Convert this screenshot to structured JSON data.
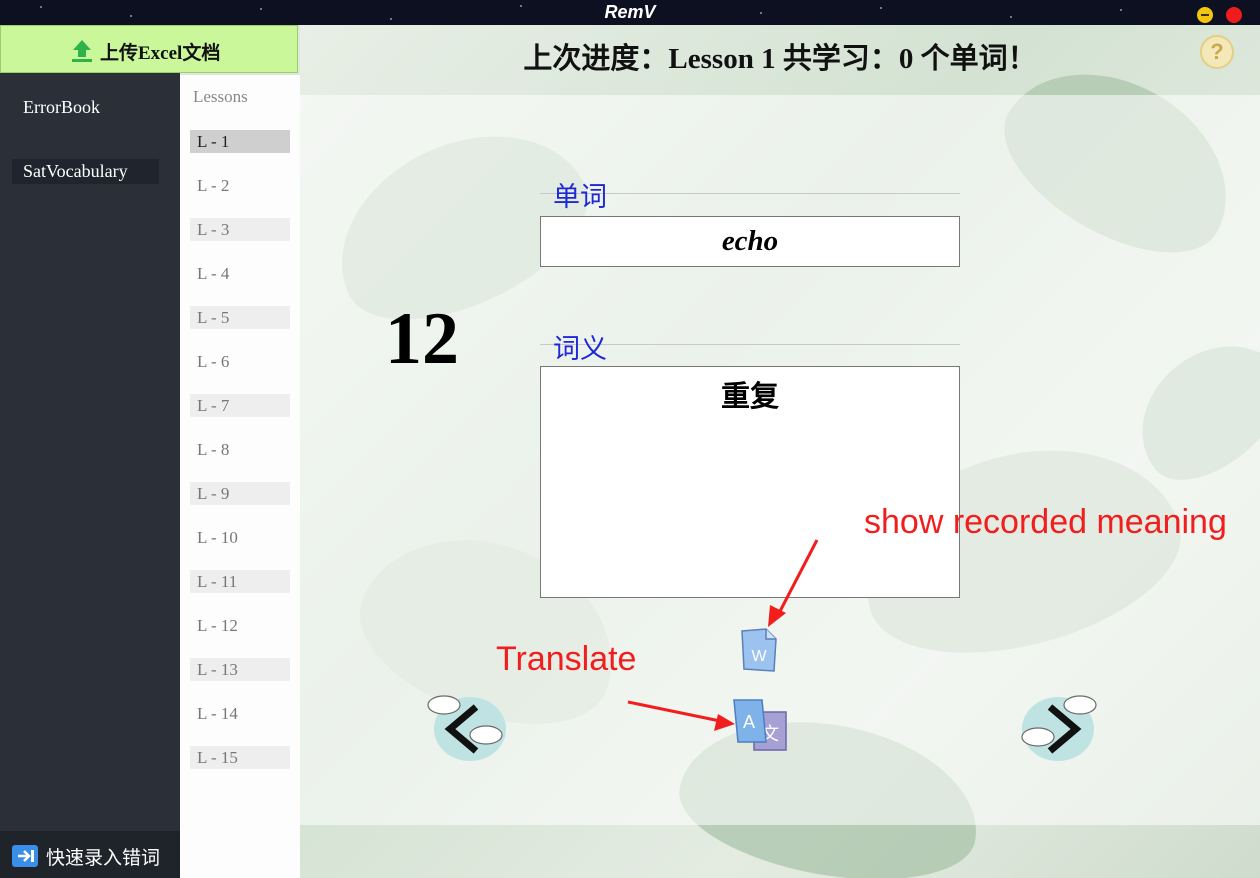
{
  "app": {
    "title": "RemV"
  },
  "sidebar": {
    "upload_label": "上传Excel文档",
    "vocabularies": [
      {
        "label": "ErrorBook"
      },
      {
        "label": "SatVocabulary"
      }
    ],
    "quick_entry_label": "快速录入错词"
  },
  "lessons": {
    "header": "Lessons",
    "items": [
      "L - 1",
      "L - 2",
      "L - 3",
      "L - 4",
      "L - 5",
      "L - 6",
      "L - 7",
      "L - 8",
      "L - 9",
      "L - 10",
      "L - 11",
      "L - 12",
      "L - 13",
      "L - 14",
      "L - 15"
    ],
    "selected": "L - 1"
  },
  "main": {
    "progress_text": "上次进度：Lesson 1  共学习：0 个单词！",
    "help_icon": "question-icon",
    "count": "12",
    "word_label": "单词",
    "word": "echo",
    "meaning_label": "词义",
    "meaning": "重复"
  },
  "annotations": {
    "show_meaning": "show recorded meaning",
    "translate": "Translate",
    "color": "#f21d1d"
  },
  "colors": {
    "upload_bg": "#c9f79a",
    "sidebar_bg": "#2b3038",
    "label_blue": "#1f27d6"
  }
}
